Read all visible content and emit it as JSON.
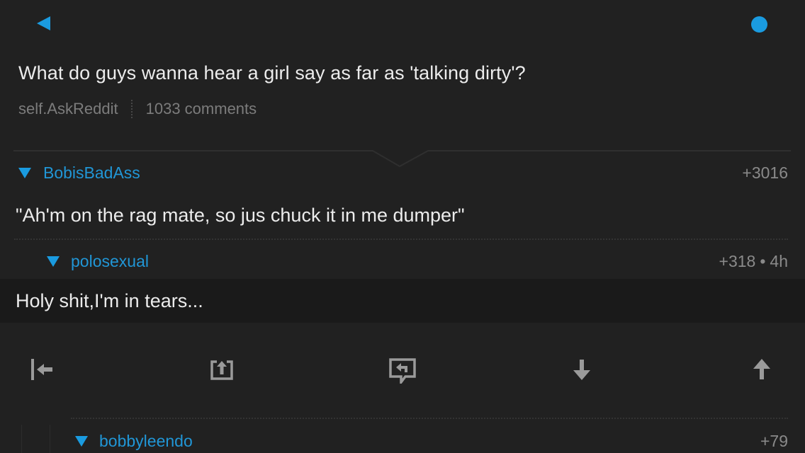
{
  "nav": {
    "back_icon": "back-arrow-icon",
    "status_icon": "unread-dot-icon",
    "accent_color": "#1a9be0"
  },
  "post": {
    "title": "What do guys wanna hear a girl say as far as 'talking dirty'?",
    "source": "self.AskReddit",
    "comments_count": "1033 comments"
  },
  "comments": [
    {
      "author": "BobisBadAss",
      "score": "+3016",
      "body": "\"Ah'm on the rag mate, so jus chuck it in me dumper\""
    },
    {
      "author": "polosexual",
      "score": "+318",
      "separator": "•",
      "age": "4h",
      "body": "Holy shit,I'm in tears..."
    },
    {
      "author": "bobbyleendo",
      "score": "+79"
    }
  ],
  "toolbar": {
    "items": [
      {
        "icon": "jump-to-top-icon"
      },
      {
        "icon": "share-icon"
      },
      {
        "icon": "reply-icon"
      },
      {
        "icon": "downvote-icon"
      },
      {
        "icon": "upvote-icon"
      }
    ]
  }
}
